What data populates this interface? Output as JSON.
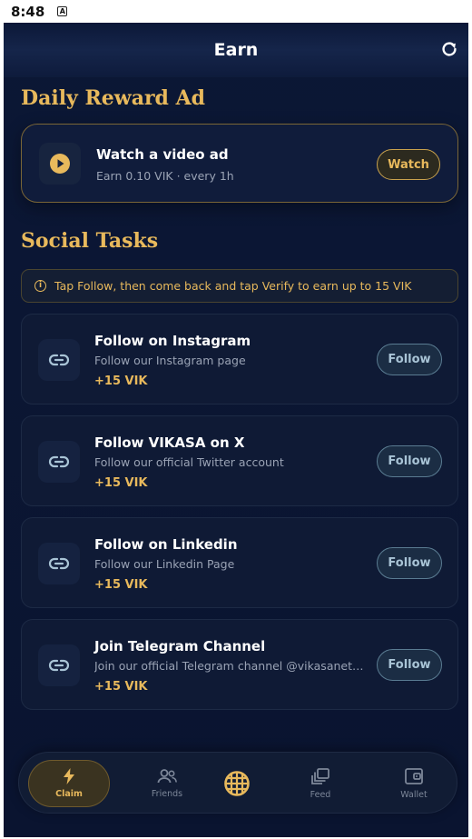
{
  "status_bar": {
    "time": "8:48",
    "indicator": "A"
  },
  "header": {
    "title": "Earn",
    "refresh_icon": "refresh-icon"
  },
  "daily_reward": {
    "section_title": "Daily Reward Ad",
    "card": {
      "icon": "play-icon",
      "title": "Watch a video ad",
      "subtitle": "Earn 0.10 VIK · every 1h",
      "button_label": "Watch"
    }
  },
  "social_tasks": {
    "section_title": "Social Tasks",
    "info_text": "Tap Follow, then come back and tap Verify to earn up to 15 VIK",
    "tasks": [
      {
        "title": "Follow on Instagram",
        "description": "Follow our Instagram page",
        "reward": "+15 VIK",
        "button_label": "Follow"
      },
      {
        "title": "Follow VIKASA on X",
        "description": "Follow our official Twitter account",
        "reward": "+15 VIK",
        "button_label": "Follow"
      },
      {
        "title": "Follow on Linkedin",
        "description": "Follow our Linkedin Page",
        "reward": "+15 VIK",
        "button_label": "Follow"
      },
      {
        "title": "Join Telegram Channel",
        "description": "Join our official Telegram channel @vikasanetwork",
        "reward": "+15 VIK",
        "button_label": "Follow"
      }
    ]
  },
  "nav": {
    "items": [
      {
        "label": "Claim",
        "icon": "lightning-icon",
        "active": true
      },
      {
        "label": "Friends",
        "icon": "friends-icon"
      },
      {
        "label": "",
        "icon": "grid-globe-icon"
      },
      {
        "label": "Feed",
        "icon": "feed-icon"
      },
      {
        "label": "Wallet",
        "icon": "wallet-icon"
      }
    ]
  },
  "colors": {
    "accent_gold": "#e8b95c",
    "background": "#0b1735",
    "follow_blue": "#a9c4d6"
  }
}
